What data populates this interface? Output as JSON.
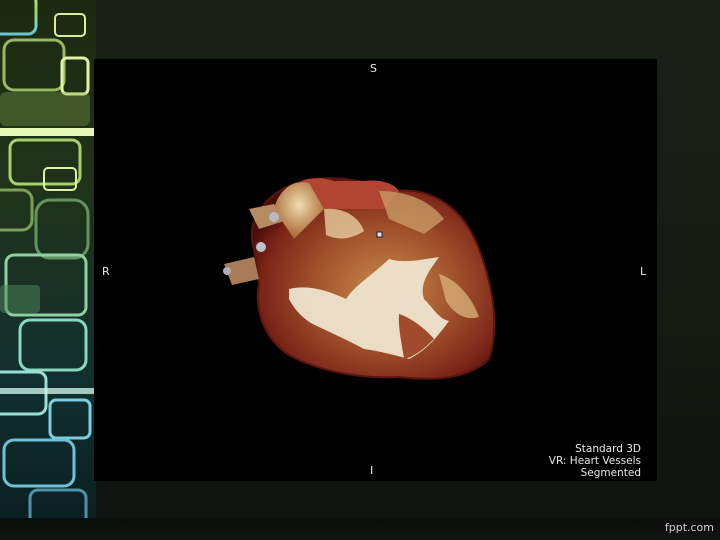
{
  "viewer": {
    "orientation": {
      "top": "S",
      "left": "R",
      "right": "L",
      "bottom": "I"
    },
    "info_lines": [
      "Standard 3D",
      "VR: Heart Vessels",
      "Segmented"
    ]
  },
  "footer": {
    "brand": "fppt.com"
  }
}
